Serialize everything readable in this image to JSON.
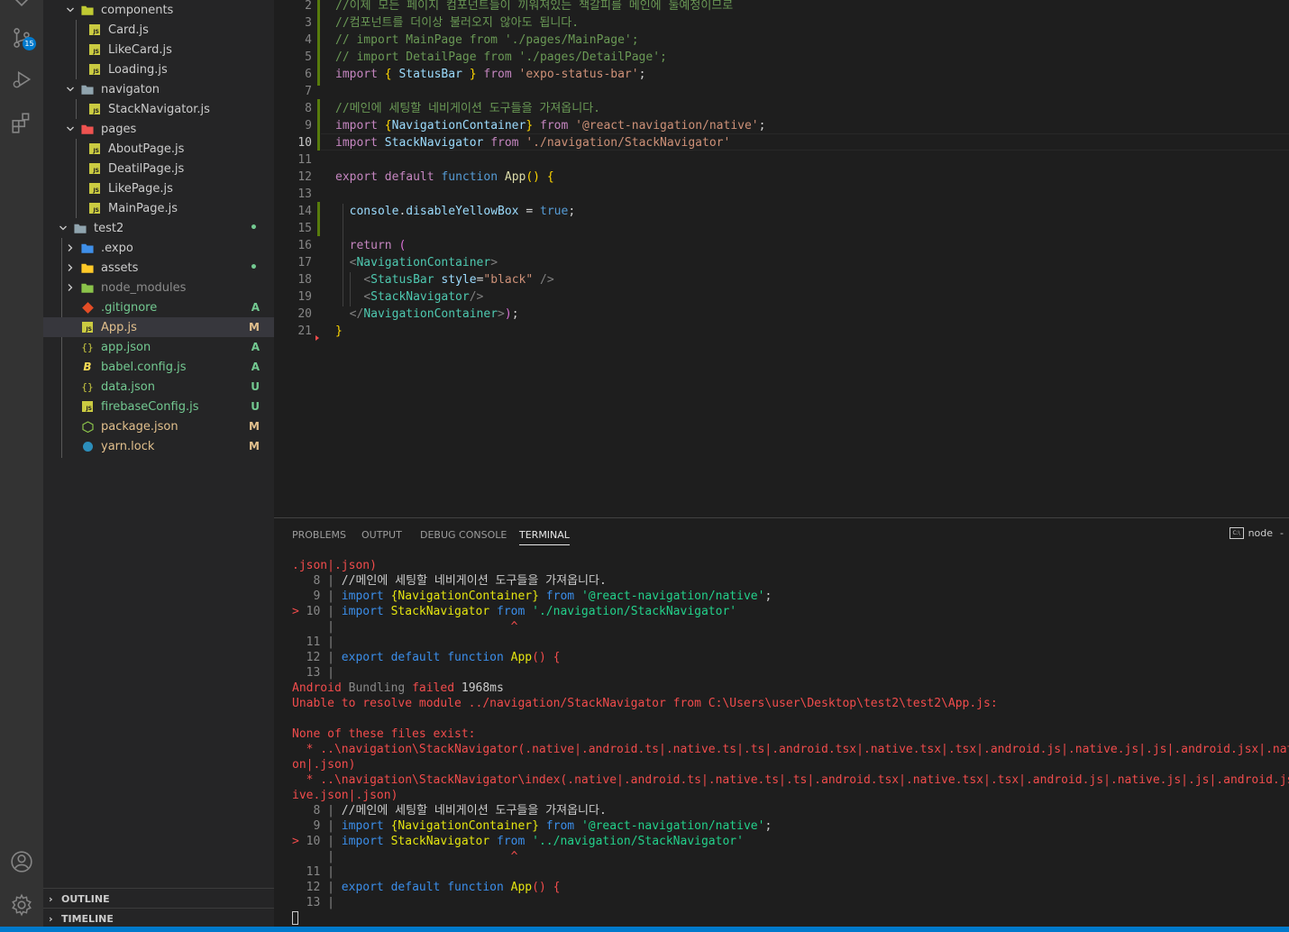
{
  "activity_bar": {
    "scm_badge": "15",
    "icons": [
      "explorer-icon",
      "source-control-icon",
      "run-debug-icon",
      "extensions-icon",
      "account-icon",
      "settings-gear-icon"
    ]
  },
  "explorer": {
    "tree": [
      {
        "label": "components",
        "kind": "folder-open",
        "indent": 1
      },
      {
        "label": "Card.js",
        "kind": "js",
        "indent": 2
      },
      {
        "label": "LikeCard.js",
        "kind": "js",
        "indent": 2
      },
      {
        "label": "Loading.js",
        "kind": "js",
        "indent": 2
      },
      {
        "label": "navigaton",
        "kind": "folder-open",
        "indent": 1
      },
      {
        "label": "StackNavigator.js",
        "kind": "js",
        "indent": 2
      },
      {
        "label": "pages",
        "kind": "folder-open",
        "indent": 1
      },
      {
        "label": "AboutPage.js",
        "kind": "js",
        "indent": 2
      },
      {
        "label": "DeatilPage.js",
        "kind": "js",
        "indent": 2
      },
      {
        "label": "LikePage.js",
        "kind": "js",
        "indent": 2
      },
      {
        "label": "MainPage.js",
        "kind": "js",
        "indent": 2
      },
      {
        "label": "test2",
        "kind": "folder-open",
        "indent": 0
      },
      {
        "label": ".expo",
        "kind": "folder",
        "indent": 1
      },
      {
        "label": "assets",
        "kind": "folder",
        "indent": 1
      },
      {
        "label": "node_modules",
        "kind": "folder",
        "indent": 1
      },
      {
        "label": ".gitignore",
        "kind": "git",
        "indent": 1
      },
      {
        "label": "App.js",
        "kind": "js",
        "indent": 1
      },
      {
        "label": "app.json",
        "kind": "json",
        "indent": 1
      },
      {
        "label": "babel.config.js",
        "kind": "babel",
        "indent": 1
      },
      {
        "label": "data.json",
        "kind": "json",
        "indent": 1
      },
      {
        "label": "firebaseConfig.js",
        "kind": "js",
        "indent": 1
      },
      {
        "label": "package.json",
        "kind": "npm",
        "indent": 1
      },
      {
        "label": "yarn.lock",
        "kind": "yarn",
        "indent": 1
      }
    ],
    "status": [
      "",
      "",
      "",
      "",
      "",
      "",
      "",
      "",
      "",
      "",
      "",
      "•",
      "",
      "•",
      "",
      "A",
      "M",
      "A",
      "A",
      "U",
      "U",
      "M",
      "M"
    ],
    "outline_label": "OUTLINE",
    "timeline_label": "TIMELINE"
  },
  "editor": {
    "line_numbers": [
      "2",
      "3",
      "4",
      "5",
      "6",
      "7",
      "8",
      "9",
      "10",
      "11",
      "12",
      "13",
      "14",
      "15",
      "16",
      "17",
      "18",
      "19",
      "20",
      "21"
    ],
    "current_line": "10",
    "lines": [
      [
        [
          "c-com",
          "//이제 모든 페이지 컴포넌트들이 끼워져있는 책갈피를 메인에 둘예정이므로"
        ]
      ],
      [
        [
          "c-com",
          "//컴포넌트를 더이상 불러오지 않아도 됩니다."
        ]
      ],
      [
        [
          "c-com",
          "// import MainPage from './pages/MainPage';"
        ]
      ],
      [
        [
          "c-com",
          "// import DetailPage from './pages/DetailPage';"
        ]
      ],
      [
        [
          "c-kw2",
          "import "
        ],
        [
          "c-brk",
          "{ "
        ],
        [
          "c-var",
          "StatusBar"
        ],
        [
          "c-brk",
          " }"
        ],
        [
          "c-kw2",
          " from "
        ],
        [
          "c-str",
          "'expo-status-bar'"
        ],
        [
          "",
          "; "
        ]
      ],
      [],
      [
        [
          "c-com",
          "//메인에 세팅할 네비게이션 도구들을 가져옵니다."
        ]
      ],
      [
        [
          "c-kw2",
          "import "
        ],
        [
          "c-brk",
          "{"
        ],
        [
          "c-var",
          "NavigationContainer"
        ],
        [
          "c-brk",
          "}"
        ],
        [
          "c-kw2",
          " from "
        ],
        [
          "c-str",
          "'@react-navigation/native'"
        ],
        [
          "",
          ";"
        ]
      ],
      [
        [
          "c-kw2",
          "import "
        ],
        [
          "c-var",
          "StackNavigator"
        ],
        [
          "c-kw2",
          " from "
        ],
        [
          "c-str",
          "'./navigation/StackNavigator'"
        ]
      ],
      [],
      [
        [
          "c-kw2",
          "export "
        ],
        [
          "c-kw2",
          "default "
        ],
        [
          "c-kw",
          "function "
        ],
        [
          "c-fn",
          "App"
        ],
        [
          "c-brk",
          "() {"
        ]
      ],
      [],
      [
        [
          "",
          "  "
        ],
        [
          "c-var",
          "console"
        ],
        [
          "",
          "."
        ],
        [
          "c-var",
          "disableYellowBox"
        ],
        [
          "",
          " = "
        ],
        [
          "c-kw",
          "true"
        ],
        [
          "",
          ";"
        ]
      ],
      [],
      [
        [
          "",
          "  "
        ],
        [
          "c-kw2",
          "return "
        ],
        [
          "c-brk2",
          "("
        ]
      ],
      [
        [
          "",
          "  "
        ],
        [
          "c-gray",
          "<"
        ],
        [
          "c-tag",
          "NavigationContainer"
        ],
        [
          "c-gray",
          ">"
        ]
      ],
      [
        [
          "",
          "    "
        ],
        [
          "c-gray",
          "<"
        ],
        [
          "c-tag",
          "StatusBar"
        ],
        [
          "",
          " "
        ],
        [
          "c-var",
          "style"
        ],
        [
          "",
          "="
        ],
        [
          "c-str",
          "\"black\""
        ],
        [
          "",
          " "
        ],
        [
          "c-gray",
          "/>"
        ]
      ],
      [
        [
          "",
          "    "
        ],
        [
          "c-gray",
          "<"
        ],
        [
          "c-tag",
          "StackNavigator"
        ],
        [
          "c-gray",
          "/>"
        ]
      ],
      [
        [
          "",
          "  "
        ],
        [
          "c-gray",
          "</"
        ],
        [
          "c-tag",
          "NavigationContainer"
        ],
        [
          "c-gray",
          ">"
        ],
        [
          "c-brk2",
          ")"
        ],
        [
          "",
          ";"
        ]
      ],
      [
        [
          "c-brk",
          "}"
        ]
      ]
    ]
  },
  "panel": {
    "tabs": [
      "PROBLEMS",
      "OUTPUT",
      "DEBUG CONSOLE",
      "TERMINAL"
    ],
    "active_tab": "TERMINAL",
    "terminal_selector": "node",
    "terminal_lines": [
      [
        [
          "t-red",
          ".json|.json)"
        ]
      ],
      [
        [
          "t-gray",
          "   8 | "
        ],
        [
          "",
          "//메인에 세팅할 네비게이션 도구들을 가져옵니다."
        ]
      ],
      [
        [
          "t-gray",
          "   9 | "
        ],
        [
          "t-blue",
          "import "
        ],
        [
          "t-yel",
          "{"
        ],
        [
          "t-yel",
          "NavigationContainer"
        ],
        [
          "t-yel",
          "}"
        ],
        [
          "t-blue",
          " from "
        ],
        [
          "t-grn",
          "'@react-navigation/native'"
        ],
        [
          "",
          ";"
        ]
      ],
      [
        [
          "t-red",
          "> "
        ],
        [
          "t-gray",
          "10 | "
        ],
        [
          "t-blue",
          "import "
        ],
        [
          "t-yel",
          "StackNavigator"
        ],
        [
          "t-blue",
          " from "
        ],
        [
          "t-grn",
          "'./navigation/StackNavigator'"
        ]
      ],
      [
        [
          "t-gray",
          "     | "
        ],
        [
          "t-red",
          "                        ^"
        ]
      ],
      [
        [
          "t-gray",
          "  11 |"
        ]
      ],
      [
        [
          "t-gray",
          "  12 | "
        ],
        [
          "t-blue",
          "export default function "
        ],
        [
          "t-yel",
          "App"
        ],
        [
          "t-red",
          "() {"
        ]
      ],
      [
        [
          "t-gray",
          "  13 |"
        ]
      ],
      [
        [
          "t-red",
          "Android "
        ],
        [
          "t-gray",
          "Bundling "
        ],
        [
          "t-red",
          "failed "
        ],
        [
          "",
          "1968ms"
        ]
      ],
      [
        [
          "t-red",
          "Unable to resolve module ../navigation/StackNavigator from C:\\Users\\user\\Desktop\\test2\\test2\\App.js:"
        ]
      ],
      [],
      [
        [
          "t-red",
          "None of these files exist:"
        ]
      ],
      [
        [
          "t-red",
          "  * ..\\navigation\\StackNavigator(.native|.android.ts|.native.ts|.ts|.android.tsx|.native.tsx|.tsx|.android.js|.native.js|.js|.android.jsx|.native.jsx|.jsx|.android.json|.native.js"
        ]
      ],
      [
        [
          "t-red",
          "on|.json)"
        ]
      ],
      [
        [
          "t-red",
          "  * ..\\navigation\\StackNavigator\\index(.native|.android.ts|.native.ts|.ts|.android.tsx|.native.tsx|.tsx|.android.js|.native.js|.js|.android.jsx|.native.jsx|.jsx|.android.json|.nat"
        ]
      ],
      [
        [
          "t-red",
          "ive.json|.json)"
        ]
      ],
      [
        [
          "t-gray",
          "   8 | "
        ],
        [
          "",
          "//메인에 세팅할 네비게이션 도구들을 가져옵니다."
        ]
      ],
      [
        [
          "t-gray",
          "   9 | "
        ],
        [
          "t-blue",
          "import "
        ],
        [
          "t-yel",
          "{"
        ],
        [
          "t-yel",
          "NavigationContainer"
        ],
        [
          "t-yel",
          "}"
        ],
        [
          "t-blue",
          " from "
        ],
        [
          "t-grn",
          "'@react-navigation/native'"
        ],
        [
          "",
          ";"
        ]
      ],
      [
        [
          "t-red",
          "> "
        ],
        [
          "t-gray",
          "10 | "
        ],
        [
          "t-blue",
          "import "
        ],
        [
          "t-yel",
          "StackNavigator"
        ],
        [
          "t-blue",
          " from "
        ],
        [
          "t-grn",
          "'../navigation/StackNavigator'"
        ]
      ],
      [
        [
          "t-gray",
          "     | "
        ],
        [
          "t-red",
          "                        ^"
        ]
      ],
      [
        [
          "t-gray",
          "  11 |"
        ]
      ],
      [
        [
          "t-gray",
          "  12 | "
        ],
        [
          "t-blue",
          "export default function "
        ],
        [
          "t-yel",
          "App"
        ],
        [
          "t-red",
          "() {"
        ]
      ],
      [
        [
          "t-gray",
          "  13 |"
        ]
      ]
    ]
  }
}
